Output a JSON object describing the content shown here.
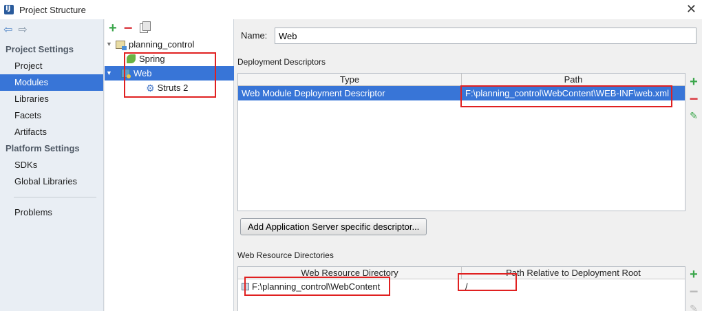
{
  "window": {
    "title": "Project Structure",
    "app_icon": "intellij-icon"
  },
  "nav": {
    "back_icon": "arrow-left-icon",
    "forward_icon": "arrow-right-icon",
    "project_settings_header": "Project Settings",
    "project_items": [
      "Project",
      "Modules",
      "Libraries",
      "Facets",
      "Artifacts"
    ],
    "platform_settings_header": "Platform Settings",
    "platform_items": [
      "SDKs",
      "Global Libraries"
    ],
    "problems": "Problems",
    "selected": "Modules"
  },
  "tree": {
    "root": "planning_control",
    "children": [
      {
        "label": "Spring",
        "icon": "spring-icon"
      },
      {
        "label": "Web",
        "icon": "web-icon",
        "selected": true
      },
      {
        "label": "Struts 2",
        "icon": "gear-icon"
      }
    ]
  },
  "facet": {
    "name_label": "Name:",
    "name_value": "Web",
    "deployment_section": "Deployment Descriptors",
    "deployment_columns": [
      "Type",
      "Path"
    ],
    "deployment_rows": [
      {
        "type": "Web Module Deployment Descriptor",
        "path": "F:\\planning_control\\WebContent\\WEB-INF\\web.xml"
      }
    ],
    "add_server_descriptor_button": "Add Application Server specific descriptor...",
    "resource_section": "Web Resource Directories",
    "resource_columns": [
      "Web Resource Directory",
      "Path Relative to Deployment Root"
    ],
    "resource_rows": [
      {
        "dir": "F:\\planning_control\\WebContent",
        "path": "/"
      }
    ]
  },
  "colors": {
    "selection": "#3875d7",
    "highlight": "#e02020",
    "add": "#3aa64a",
    "remove": "#d9363e"
  }
}
